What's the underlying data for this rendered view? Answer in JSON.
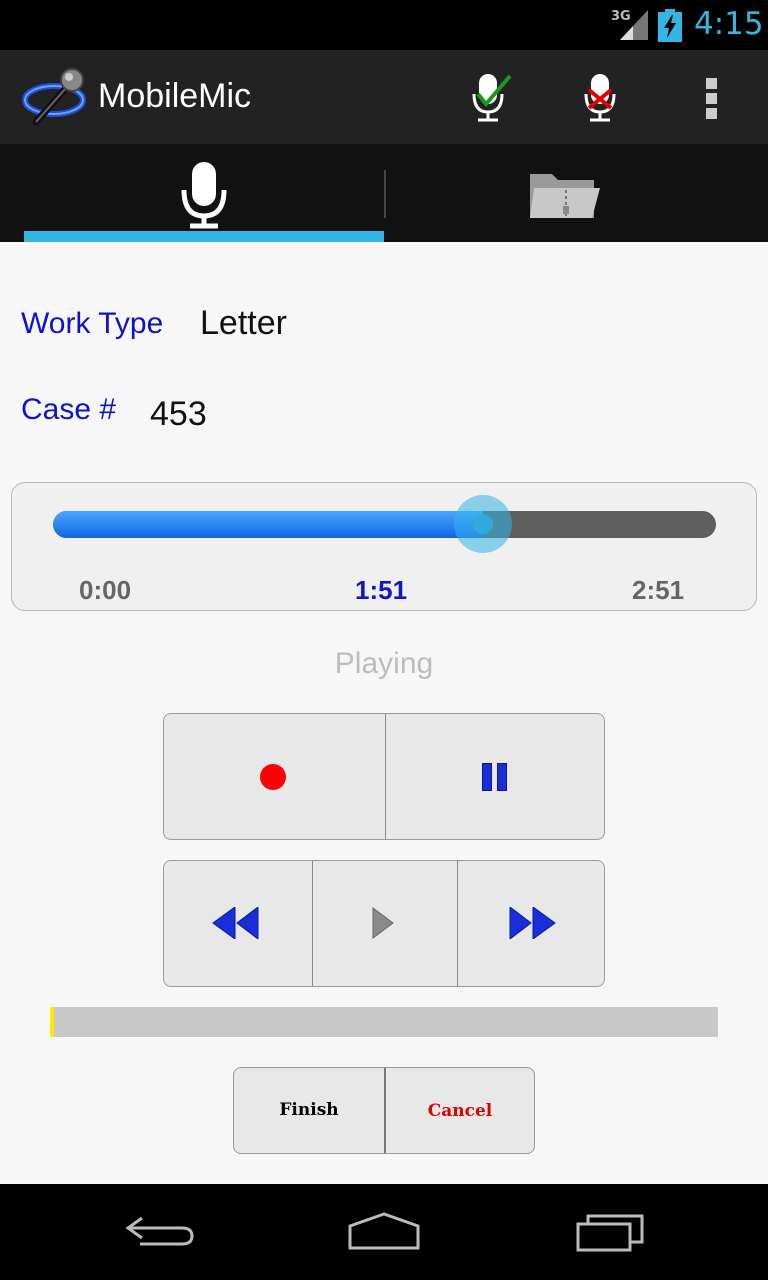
{
  "status_bar": {
    "network": "3G",
    "time": "4:15"
  },
  "action_bar": {
    "app_title": "MobileMic",
    "icons": [
      "mobilemic-logo-icon",
      "accept-recording-icon",
      "reject-recording-icon",
      "overflow-menu-icon"
    ]
  },
  "tabs": [
    {
      "icon": "microphone-icon",
      "selected": true
    },
    {
      "icon": "zip-folder-icon",
      "selected": false
    }
  ],
  "form": {
    "work_type_label": "Work Type",
    "work_type_value": "Letter",
    "case_label": "Case #",
    "case_value": "453"
  },
  "playback": {
    "start": "0:00",
    "current": "1:51",
    "total": "2:51",
    "progress_fraction": 0.649,
    "status": "Playing"
  },
  "controls": [
    "record",
    "pause",
    "rewind",
    "play",
    "fast-forward"
  ],
  "level_meter": {
    "level_fraction": 0.006
  },
  "actions": {
    "finish": "Finish",
    "cancel": "Cancel"
  },
  "colors": {
    "accent": "#33b5e5",
    "label": "#1010d0",
    "record": "#ff0000",
    "cancel": "#e00000",
    "control_blue": "#1a2ed8"
  }
}
